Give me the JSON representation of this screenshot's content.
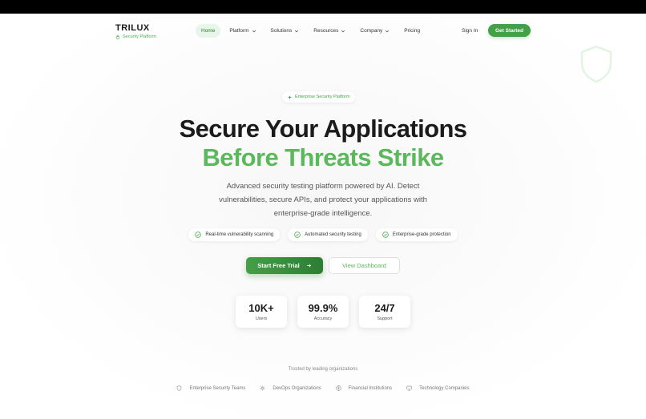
{
  "brand": {
    "name": "TRILUX",
    "tagline": "Security Platform"
  },
  "nav": {
    "items": [
      {
        "label": "Home",
        "active": true,
        "dropdown": false
      },
      {
        "label": "Platform",
        "active": false,
        "dropdown": true
      },
      {
        "label": "Solutions",
        "active": false,
        "dropdown": true
      },
      {
        "label": "Resources",
        "active": false,
        "dropdown": true
      },
      {
        "label": "Company",
        "active": false,
        "dropdown": true
      },
      {
        "label": "Pricing",
        "active": false,
        "dropdown": false
      }
    ],
    "sign_in": "Sign In",
    "get_started": "Get Started"
  },
  "hero": {
    "badge": "Enterprise Security Platform",
    "title_line1": "Secure Your Applications",
    "title_line2": "Before Threats Strike",
    "description": "Advanced security testing platform powered by AI. Detect vulnerabilities, secure APIs, and protect your applications with enterprise-grade intelligence.",
    "features": [
      "Real-time vulnerability scanning",
      "Automated security testing",
      "Enterprise-grade protection"
    ],
    "cta_primary": "Start Free Trial",
    "cta_secondary": "View Dashboard"
  },
  "stats": [
    {
      "value": "10K+",
      "label": "Users"
    },
    {
      "value": "99.9%",
      "label": "Accuracy"
    },
    {
      "value": "24/7",
      "label": "Support"
    }
  ],
  "trusted": {
    "heading": "Trusted by leading organizations",
    "orgs": [
      {
        "label": "Enterprise Security Teams",
        "icon": "shield-icon"
      },
      {
        "label": "DevOps Organizations",
        "icon": "gear-icon"
      },
      {
        "label": "Financial Institutions",
        "icon": "dollar-icon"
      },
      {
        "label": "Technology Companies",
        "icon": "monitor-icon"
      }
    ]
  },
  "colors": {
    "accent": "#43a047",
    "accent_dark": "#2e7d32",
    "accent_light": "#5cb85c",
    "text_dark": "#1b1b1b"
  }
}
